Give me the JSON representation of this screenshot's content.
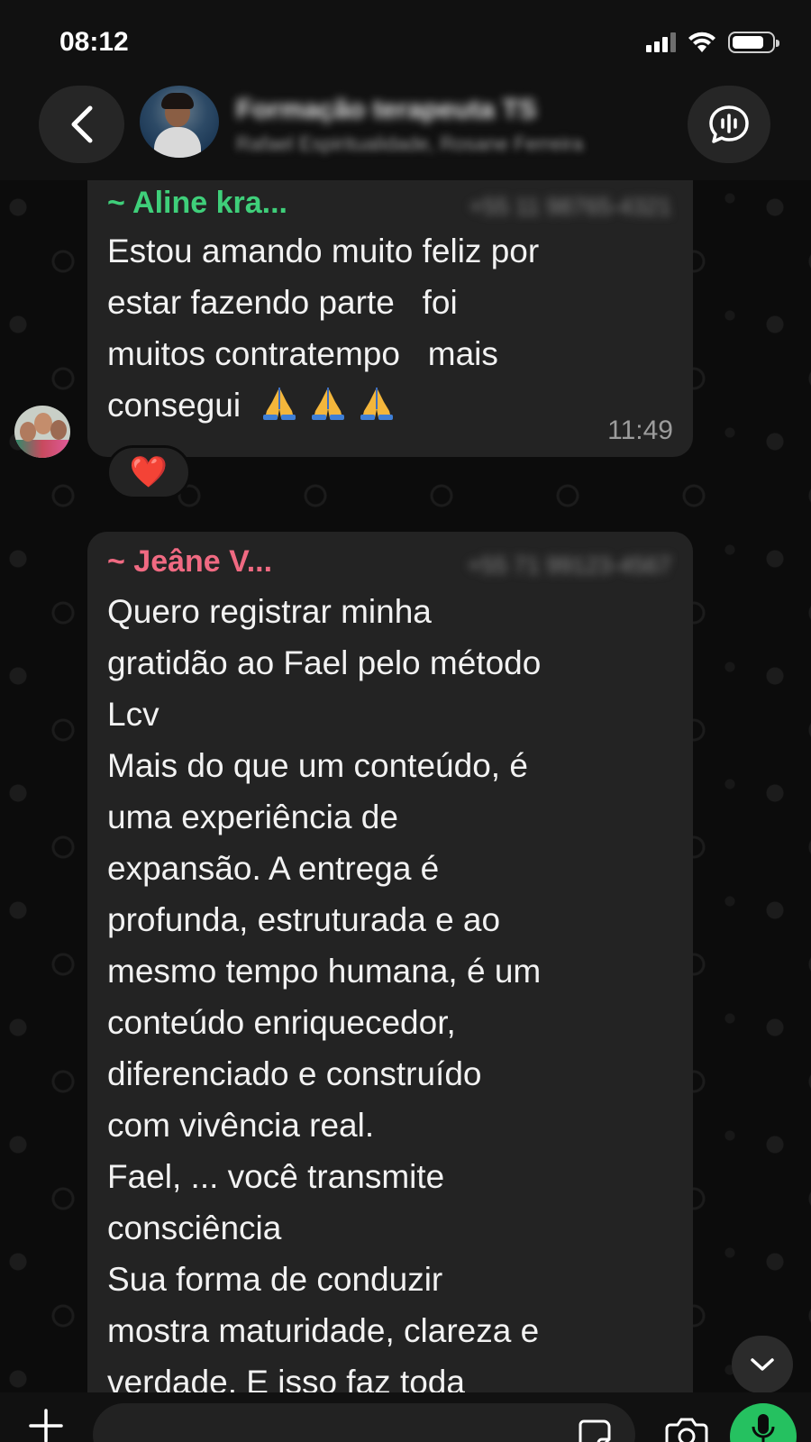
{
  "status_bar": {
    "time": "08:12"
  },
  "header": {
    "group_name": "Formação terapeuta TS",
    "group_subtitle": "Rafael Espiritualidade, Rosane Ferreira"
  },
  "messages": [
    {
      "sender": "~ Aline kra...",
      "sender_color": "#3fcf7a",
      "phone": "+55 11 98765-4321",
      "text": "Estou amando muito feliz por\nestar fazendo parte   foi\nmuitos contratempo   mais\nconsegui  ",
      "emoji": "folded-hands x3",
      "time": "11:49",
      "reaction": "❤️"
    },
    {
      "sender": "~ Jeâne V...",
      "sender_color": "#f06a82",
      "phone": "+55 71 99123-4567",
      "text": "Quero registrar minha\ngratidão ao Fael pelo método\nLcv\nMais do que um conteúdo, é\numa experiência de\nexpansão. A entrega é\nprofunda, estruturada e ao\nmesmo tempo humana, é um\nconteúdo enriquecedor,\ndiferenciado e construído\ncom vivência real.\nFael, ... você transmite\nconsciência\nSua forma de conduzir\nmostra maturidade, clareza e\nverdade. E isso faz toda"
    }
  ],
  "composer": {
    "placeholder": ""
  },
  "colors": {
    "accent": "#25c160",
    "bubble": "#232323",
    "background": "#0c0c0c"
  },
  "icons": [
    "back-icon",
    "voice-chat-icon",
    "chevron-down-icon",
    "plus-icon",
    "sticker-icon",
    "camera-icon",
    "mic-icon",
    "folded-hands-icon",
    "heart-icon"
  ]
}
